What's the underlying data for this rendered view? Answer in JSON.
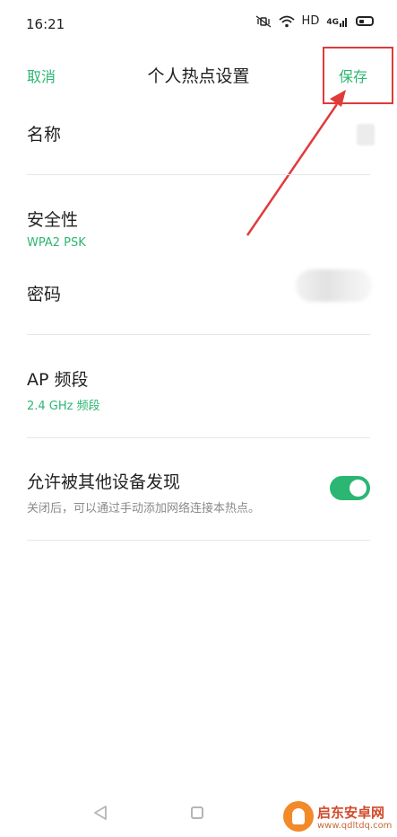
{
  "status_bar": {
    "time": "16:21",
    "hd": "HD",
    "network": "4G",
    "icons": [
      "mute-vibrate-icon",
      "wifi-icon",
      "signal-icon",
      "battery-icon"
    ]
  },
  "header": {
    "cancel_label": "取消",
    "title": "个人热点设置",
    "save_label": "保存"
  },
  "rows": {
    "name": {
      "label": "名称"
    },
    "security": {
      "label": "安全性",
      "value": "WPA2 PSK"
    },
    "password": {
      "label": "密码"
    },
    "band": {
      "label": "AP 频段",
      "value": "2.4 GHz 频段"
    },
    "discoverable": {
      "label": "允许被其他设备发现",
      "description": "关闭后，可以通过手动添加网络连接本热点。",
      "enabled": true
    }
  },
  "watermark": {
    "name": "启东安卓网",
    "url": "www.qdltdq.com"
  },
  "colors": {
    "accent": "#2bb673",
    "annotation": "#e03a3a"
  }
}
